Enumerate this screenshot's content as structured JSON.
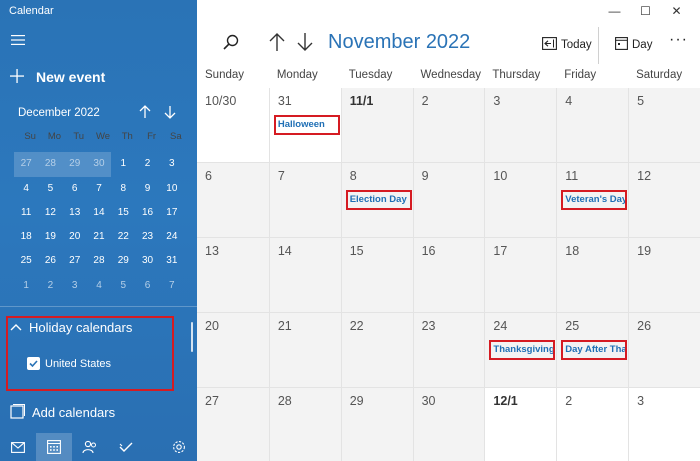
{
  "window": {
    "title": "Calendar",
    "minimize": "—",
    "maximize": "☐",
    "close": "✕"
  },
  "sidebar": {
    "new_event": "New event",
    "mini_calendar": {
      "month_label": "December 2022",
      "weekdays": [
        "Su",
        "Mo",
        "Tu",
        "We",
        "Th",
        "Fr",
        "Sa"
      ],
      "weeks": [
        [
          {
            "d": "27",
            "o": true
          },
          {
            "d": "28",
            "o": true
          },
          {
            "d": "29",
            "o": true
          },
          {
            "d": "30",
            "o": true
          },
          {
            "d": "1"
          },
          {
            "d": "2"
          },
          {
            "d": "3"
          }
        ],
        [
          {
            "d": "4"
          },
          {
            "d": "5"
          },
          {
            "d": "6"
          },
          {
            "d": "7"
          },
          {
            "d": "8"
          },
          {
            "d": "9"
          },
          {
            "d": "10"
          }
        ],
        [
          {
            "d": "11"
          },
          {
            "d": "12"
          },
          {
            "d": "13"
          },
          {
            "d": "14"
          },
          {
            "d": "15"
          },
          {
            "d": "16"
          },
          {
            "d": "17"
          }
        ],
        [
          {
            "d": "18"
          },
          {
            "d": "19"
          },
          {
            "d": "20"
          },
          {
            "d": "21"
          },
          {
            "d": "22"
          },
          {
            "d": "23"
          },
          {
            "d": "24"
          }
        ],
        [
          {
            "d": "25"
          },
          {
            "d": "26"
          },
          {
            "d": "27"
          },
          {
            "d": "28"
          },
          {
            "d": "29"
          },
          {
            "d": "30"
          },
          {
            "d": "31"
          }
        ],
        [
          {
            "d": "1",
            "o": true
          },
          {
            "d": "2",
            "o": true
          },
          {
            "d": "3",
            "o": true
          },
          {
            "d": "4",
            "o": true
          },
          {
            "d": "5",
            "o": true
          },
          {
            "d": "6",
            "o": true
          },
          {
            "d": "7",
            "o": true
          }
        ]
      ]
    },
    "holiday_calendars": "Holiday calendars",
    "holiday_items": [
      {
        "label": "United States",
        "checked": true
      }
    ],
    "add_calendars": "Add calendars",
    "bottom_nav": [
      "mail-icon",
      "calendar-icon",
      "people-icon",
      "todo-icon",
      "settings-icon"
    ]
  },
  "toolbar": {
    "title": "November 2022",
    "today": "Today",
    "view": "Day",
    "more": "···"
  },
  "calendar": {
    "weekdays": [
      "Sunday",
      "Monday",
      "Tuesday",
      "Wednesday",
      "Thursday",
      "Friday",
      "Saturday"
    ],
    "weeks": [
      [
        {
          "n": "10/30",
          "w": true
        },
        {
          "n": "31",
          "w": true,
          "e": "Halloween"
        },
        {
          "n": "11/1",
          "b": true
        },
        {
          "n": "2"
        },
        {
          "n": "3"
        },
        {
          "n": "4"
        },
        {
          "n": "5"
        }
      ],
      [
        {
          "n": "6"
        },
        {
          "n": "7"
        },
        {
          "n": "8",
          "e": "Election Day"
        },
        {
          "n": "9"
        },
        {
          "n": "10"
        },
        {
          "n": "11",
          "e": "Veteran's Day"
        },
        {
          "n": "12"
        }
      ],
      [
        {
          "n": "13"
        },
        {
          "n": "14"
        },
        {
          "n": "15"
        },
        {
          "n": "16"
        },
        {
          "n": "17"
        },
        {
          "n": "18"
        },
        {
          "n": "19"
        }
      ],
      [
        {
          "n": "20"
        },
        {
          "n": "21"
        },
        {
          "n": "22"
        },
        {
          "n": "23"
        },
        {
          "n": "24",
          "e": "Thanksgiving"
        },
        {
          "n": "25",
          "e": "Day After Tha"
        },
        {
          "n": "26"
        }
      ],
      [
        {
          "n": "27"
        },
        {
          "n": "28"
        },
        {
          "n": "29"
        },
        {
          "n": "30"
        },
        {
          "n": "12/1",
          "b": true,
          "w": true
        },
        {
          "n": "2",
          "w": true
        },
        {
          "n": "3",
          "w": true
        }
      ]
    ]
  },
  "colors": {
    "accent": "#2a73b6",
    "highlight_box": "#d51b22"
  }
}
